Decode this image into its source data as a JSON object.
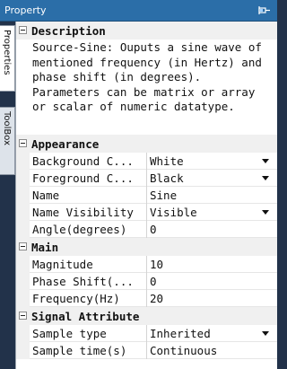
{
  "window": {
    "title": "Property",
    "pin_icon": "pin-icon"
  },
  "side_tabs": [
    {
      "label": "Properties",
      "active": true
    },
    {
      "label": "ToolBox",
      "active": false
    }
  ],
  "sections": {
    "description": {
      "title": "Description",
      "text": "Source-Sine: Ouputs a sine wave of mentioned frequency (in Hertz) and phase shift (in degrees). Parameters can be matrix or array or scalar of numeric datatype."
    },
    "appearance": {
      "title": "Appearance",
      "rows": [
        {
          "name": "Background C...",
          "value": "White",
          "dropdown": true
        },
        {
          "name": "Foreground C...",
          "value": "Black",
          "dropdown": true
        },
        {
          "name": "Name",
          "value": "Sine",
          "dropdown": false
        },
        {
          "name": "Name Visibility",
          "value": "Visible",
          "dropdown": true
        },
        {
          "name": "Angle(degrees)",
          "value": "0",
          "dropdown": false
        }
      ]
    },
    "main": {
      "title": "Main",
      "rows": [
        {
          "name": "Magnitude",
          "value": "10",
          "dropdown": false
        },
        {
          "name": "Phase Shift(...",
          "value": "0",
          "dropdown": false
        },
        {
          "name": "Frequency(Hz)",
          "value": "20",
          "dropdown": false
        }
      ]
    },
    "signal_attribute": {
      "title": "Signal Attribute",
      "rows": [
        {
          "name": "Sample type",
          "value": "Inherited",
          "dropdown": true
        },
        {
          "name": "Sample time(s)",
          "value": "Continuous",
          "dropdown": false
        }
      ]
    }
  }
}
